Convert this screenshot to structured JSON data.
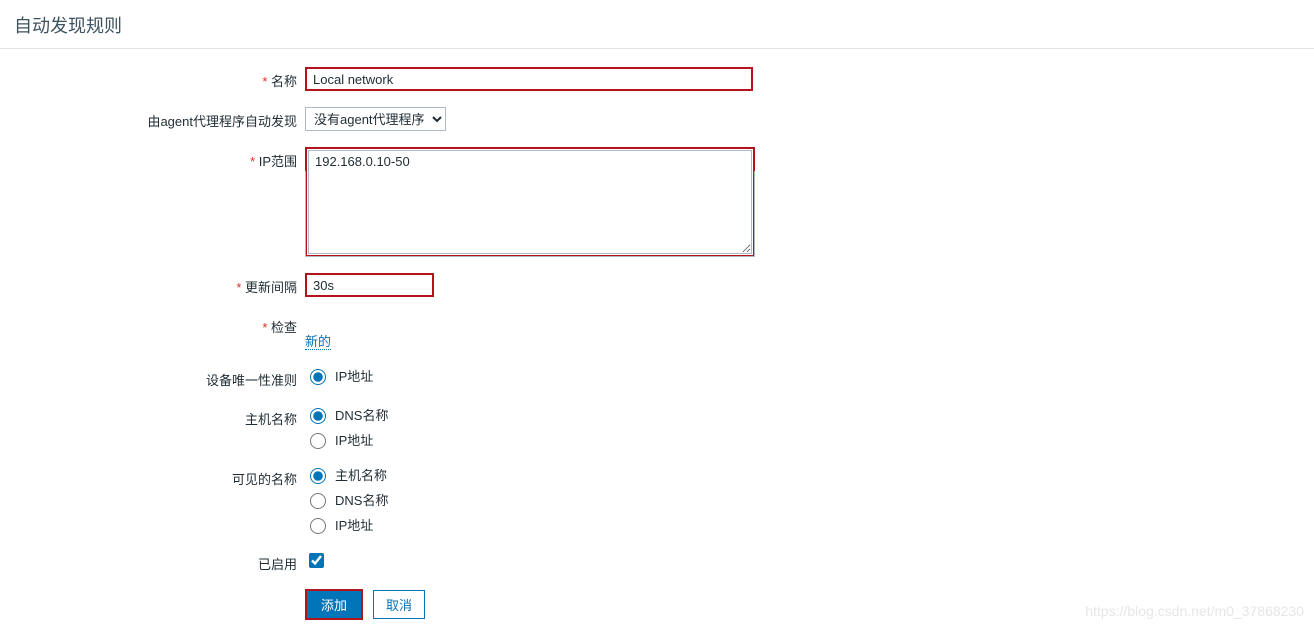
{
  "header": {
    "title": "自动发现规则"
  },
  "form": {
    "name": {
      "label": "名称",
      "value": "Local network"
    },
    "proxy": {
      "label": "由agent代理程序自动发现",
      "selected": "没有agent代理程序"
    },
    "ip_range": {
      "label": "IP范围",
      "value": "192.168.0.10-50"
    },
    "interval": {
      "label": "更新间隔",
      "value": "30s"
    },
    "checks": {
      "label": "检查",
      "new_link": "新的"
    },
    "uniqueness": {
      "label": "设备唯一性准则",
      "options": {
        "ip": "IP地址"
      },
      "selected": "ip"
    },
    "host_name": {
      "label": "主机名称",
      "options": {
        "dns": "DNS名称",
        "ip": "IP地址"
      },
      "selected": "dns"
    },
    "visible_name": {
      "label": "可见的名称",
      "options": {
        "host": "主机名称",
        "dns": "DNS名称",
        "ip": "IP地址"
      },
      "selected": "host"
    },
    "enabled": {
      "label": "已启用",
      "checked": true
    }
  },
  "buttons": {
    "submit": "添加",
    "cancel": "取消"
  },
  "watermark": "https://blog.csdn.net/m0_37868230"
}
